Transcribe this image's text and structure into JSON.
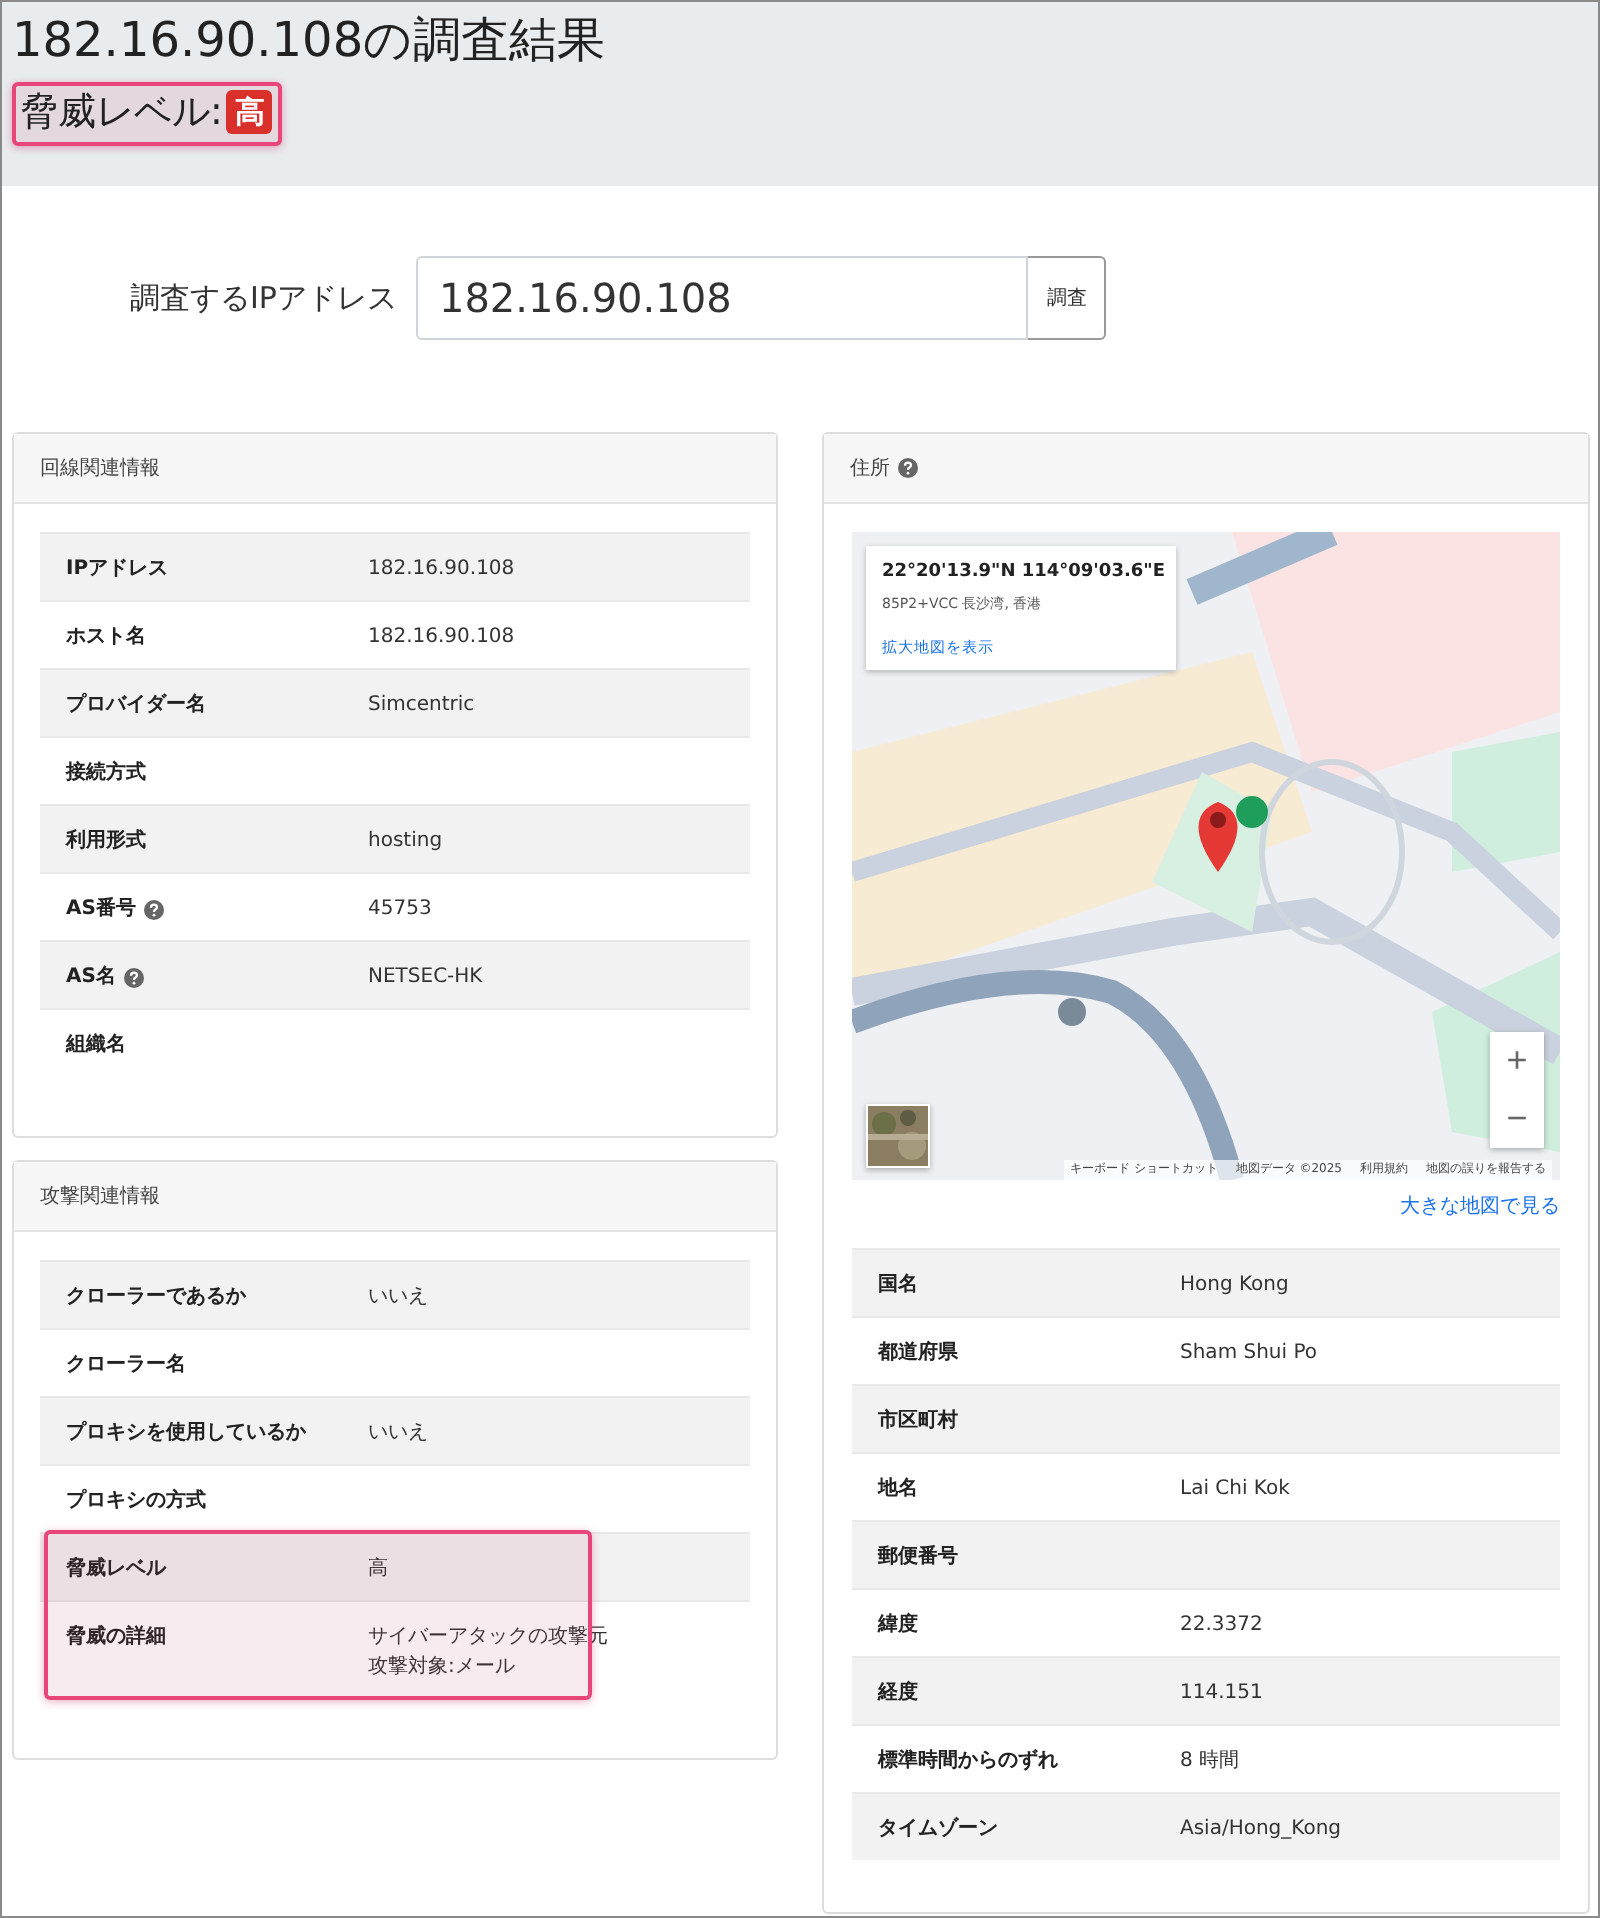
{
  "header": {
    "title": "182.16.90.108の調査結果",
    "threat": {
      "label": "脅威レベル:",
      "badge": "高",
      "highlighted": true
    }
  },
  "search": {
    "label": "調査するIPアドレス",
    "value": "182.16.90.108",
    "button": "調査"
  },
  "left_panels": [
    {
      "title": "回線関連情報",
      "rows": [
        {
          "label": "IPアドレス",
          "value": "182.16.90.108"
        },
        {
          "label": "ホスト名",
          "value": "182.16.90.108"
        },
        {
          "label": "プロバイダー名",
          "value": "Simcentric"
        },
        {
          "label": "接続方式"
        },
        {
          "label": "利用形式",
          "value": "hosting"
        },
        {
          "label": "AS番号",
          "help": true,
          "value": "45753"
        },
        {
          "label": "AS名",
          "help": true,
          "value": "NETSEC-HK"
        },
        {
          "label": "組織名"
        }
      ]
    },
    {
      "title": "攻撃関連情報",
      "rows": [
        {
          "label": "クローラーであるか",
          "value": "いいえ",
          "highlighted": false
        },
        {
          "label": "クローラー名",
          "highlighted": false
        },
        {
          "label": "プロキシを使用しているか",
          "value": "いいえ",
          "highlighted": false
        },
        {
          "label": "プロキシの方式",
          "highlighted": false
        },
        {
          "label": "脅威レベル",
          "value": "高",
          "highlighted": true
        },
        {
          "label": "脅威の詳細",
          "value_lines": [
            "サイバーアタックの攻撃元",
            "攻撃対象:メール"
          ],
          "highlighted": true
        }
      ]
    }
  ],
  "address": {
    "title": "住所",
    "help": true,
    "map": {
      "kind": "picture",
      "info": {
        "coords": "22°20'13.9\"N 114°09'03.6\"E",
        "plus_code": "85P2+VCC 長沙湾, 香港",
        "link": "拡大地図を表示"
      },
      "zoom_in": "+",
      "zoom_out": "−",
      "attribution": [
        "キーボード ショートカット",
        "地図データ ©2025",
        "利用規約",
        "地図の誤りを報告する"
      ]
    },
    "larger_map_link": "大きな地図で見る",
    "rows": [
      {
        "label": "国名",
        "value": "Hong Kong"
      },
      {
        "label": "都道府県",
        "value": "Sham Shui Po"
      },
      {
        "label": "市区町村"
      },
      {
        "label": "地名",
        "value": "Lai Chi Kok"
      },
      {
        "label": "郵便番号"
      },
      {
        "label": "緯度",
        "value": "22.3372"
      },
      {
        "label": "経度",
        "value": "114.151"
      },
      {
        "label": "標準時間からのずれ",
        "value": "8 時間"
      },
      {
        "label": "タイムゾーン",
        "value": "Asia/Hong_Kong"
      }
    ]
  }
}
